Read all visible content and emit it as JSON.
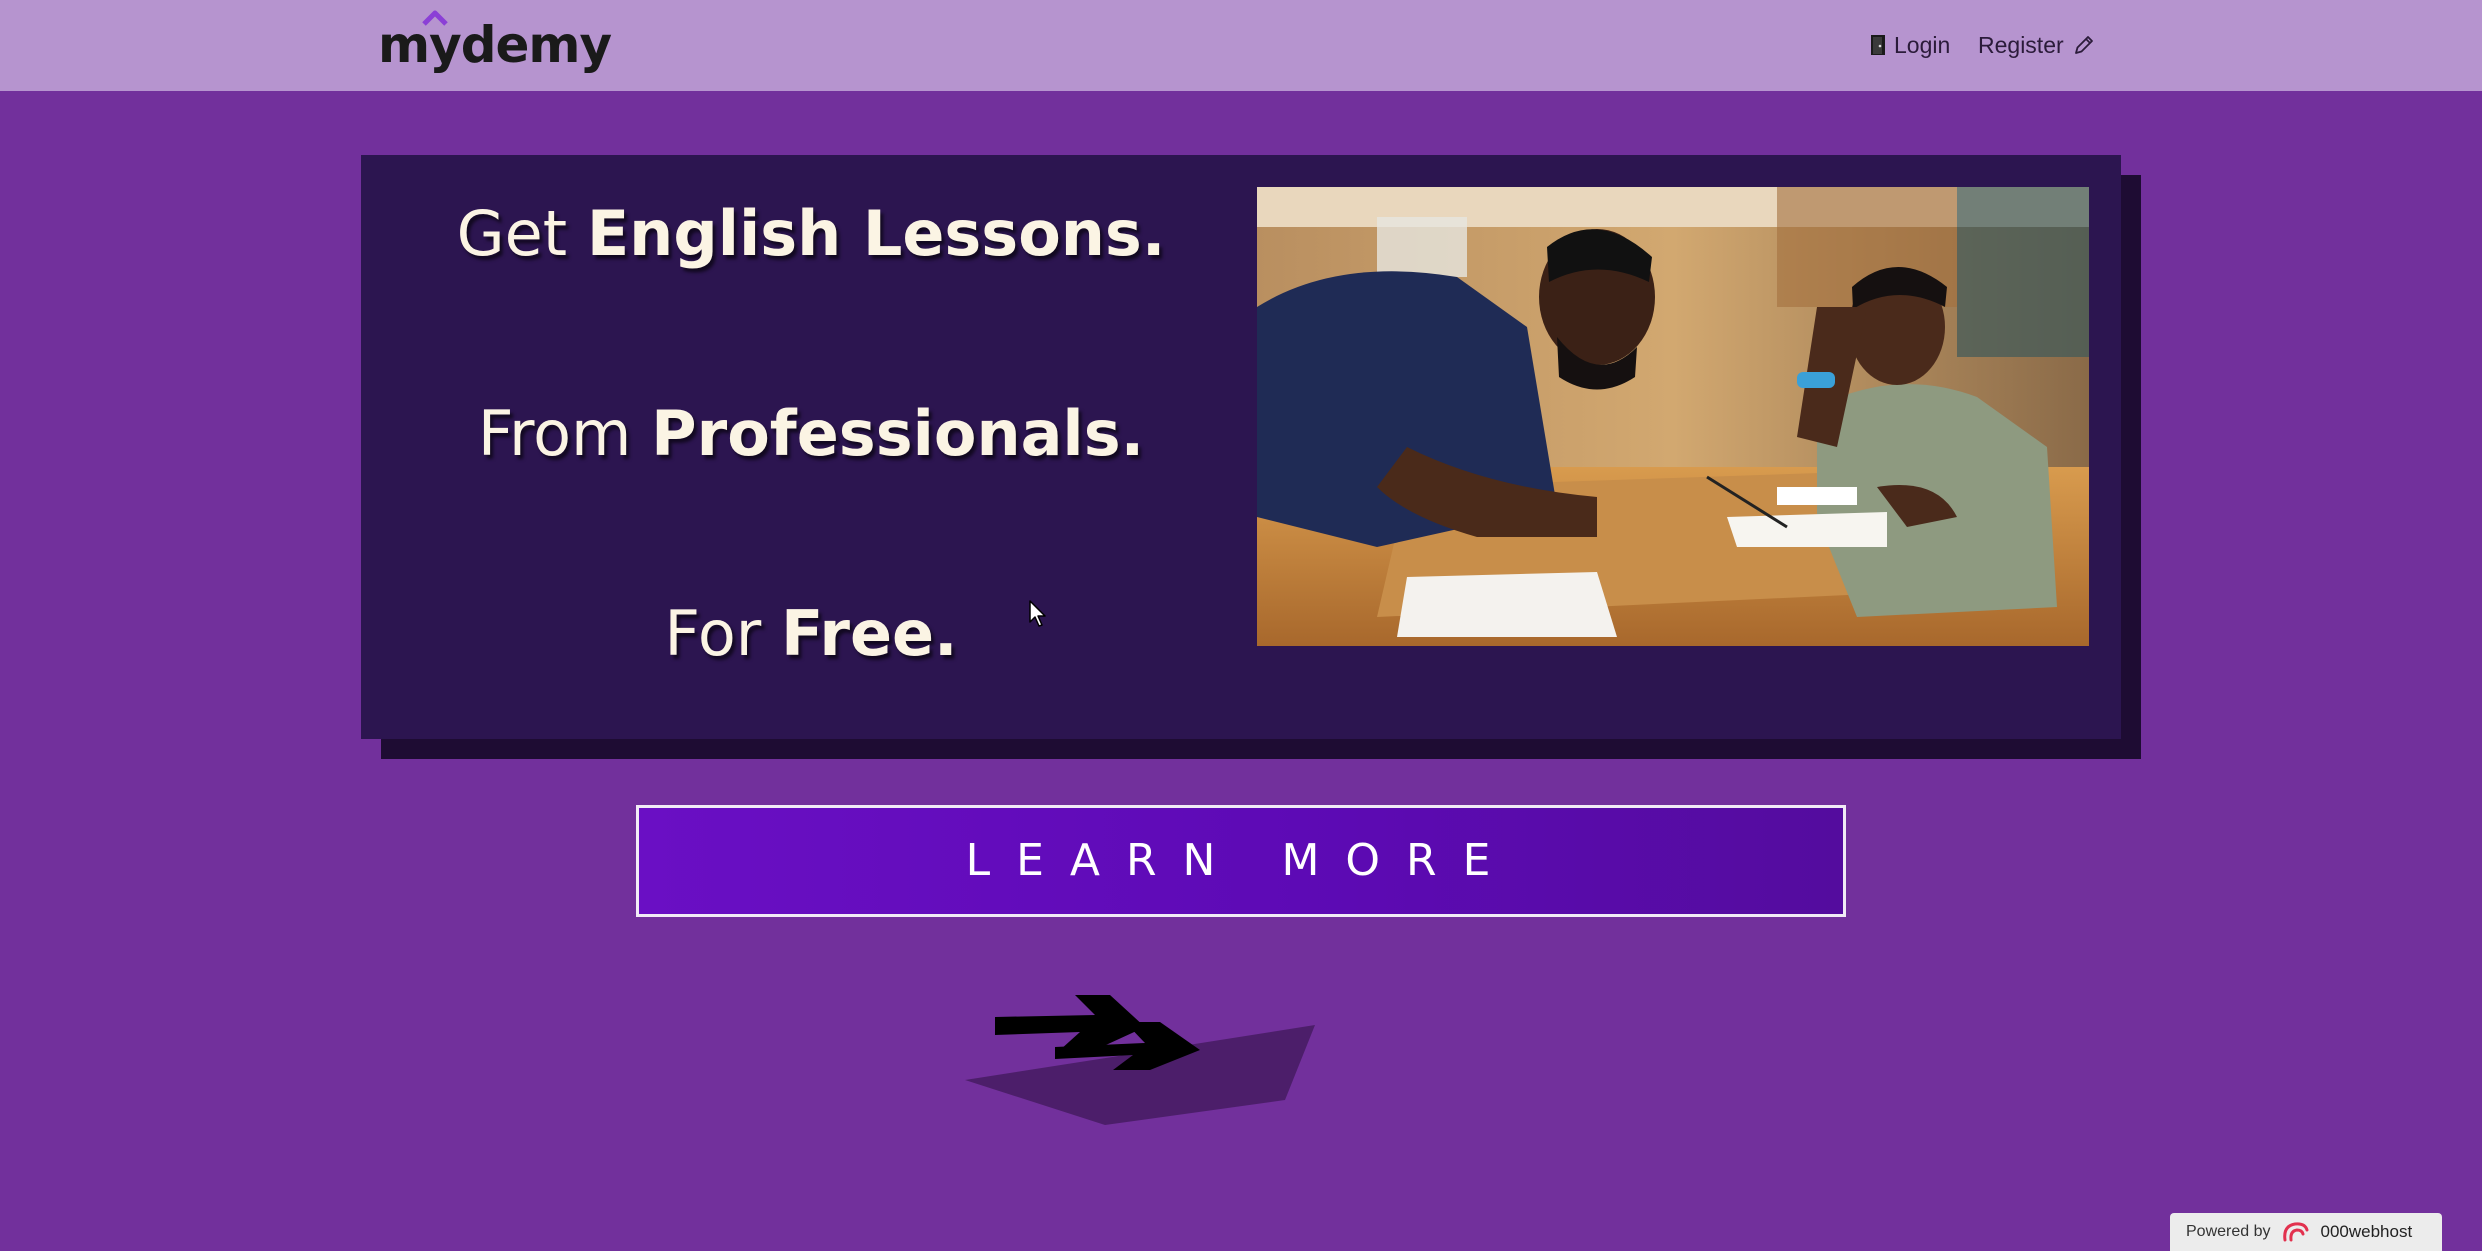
{
  "navbar": {
    "logo_text": "mydemy",
    "login_label": "Login",
    "register_label": "Register"
  },
  "hero": {
    "line1_normal": "Get ",
    "line1_bold": "English Lessons.",
    "line2_normal": "From ",
    "line2_bold": "Professionals.",
    "line3_normal": "For ",
    "line3_bold": "Free."
  },
  "cta": {
    "learn_more_label": "LEARN MORE"
  },
  "footer_badge": {
    "powered_label": "Powered by",
    "brand_label": "000webhost"
  },
  "colors": {
    "background": "#72309c",
    "navbar": "#b694cf",
    "hero_panel": "#2c1550",
    "button": "#5d0ab5"
  }
}
